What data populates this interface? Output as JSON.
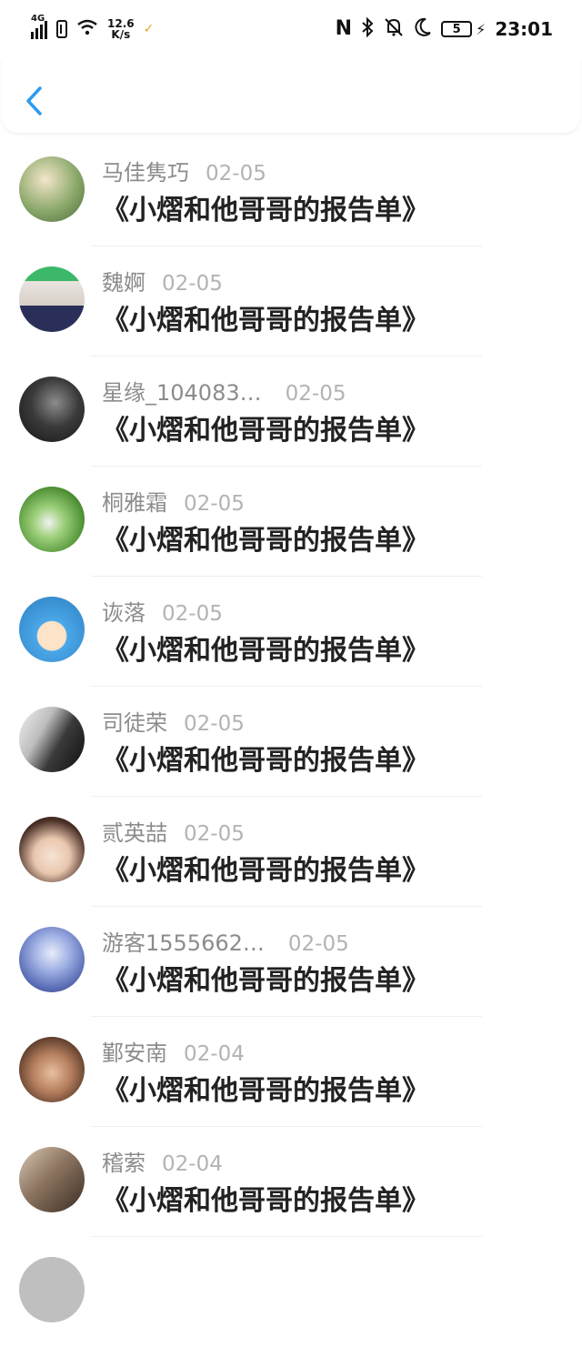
{
  "status": {
    "network": "4G",
    "speed_value": "12.6",
    "speed_unit": "K/s",
    "battery": "5",
    "time": "23:01"
  },
  "colors": {
    "accent": "#2d9bf0",
    "name": "#8c8c8c",
    "date": "#b3b3b3"
  },
  "items": [
    {
      "name": "马佳隽巧",
      "date": "02-05",
      "title": "《小熠和他哥哥的报告单》",
      "avatar_color": "#8aa86a"
    },
    {
      "name": "魏婀",
      "date": "02-05",
      "title": "《小熠和他哥哥的报告单》",
      "avatar_color": "#6a6f88"
    },
    {
      "name": "星缘_104083…",
      "date": "02-05",
      "title": "《小熠和他哥哥的报告单》",
      "avatar_color": "#2d2d2d"
    },
    {
      "name": "桐雅霜",
      "date": "02-05",
      "title": "《小熠和他哥哥的报告单》",
      "avatar_color": "#6cab4a"
    },
    {
      "name": "诙落",
      "date": "02-05",
      "title": "《小熠和他哥哥的报告单》",
      "avatar_color": "#4aa7e8"
    },
    {
      "name": "司徒荣",
      "date": "02-05",
      "title": "《小熠和他哥哥的报告单》",
      "avatar_color": "#555555"
    },
    {
      "name": "贰英喆",
      "date": "02-05",
      "title": "《小熠和他哥哥的报告单》",
      "avatar_color": "#c9a08a"
    },
    {
      "name": "游客1555662…",
      "date": "02-05",
      "title": "《小熠和他哥哥的报告单》",
      "avatar_color": "#7c8fc9"
    },
    {
      "name": "鄞安南",
      "date": "02-04",
      "title": "《小熠和他哥哥的报告单》",
      "avatar_color": "#9b6a52"
    },
    {
      "name": "稽萦",
      "date": "02-04",
      "title": "《小熠和他哥哥的报告单》",
      "avatar_color": "#7a6a5a"
    }
  ]
}
